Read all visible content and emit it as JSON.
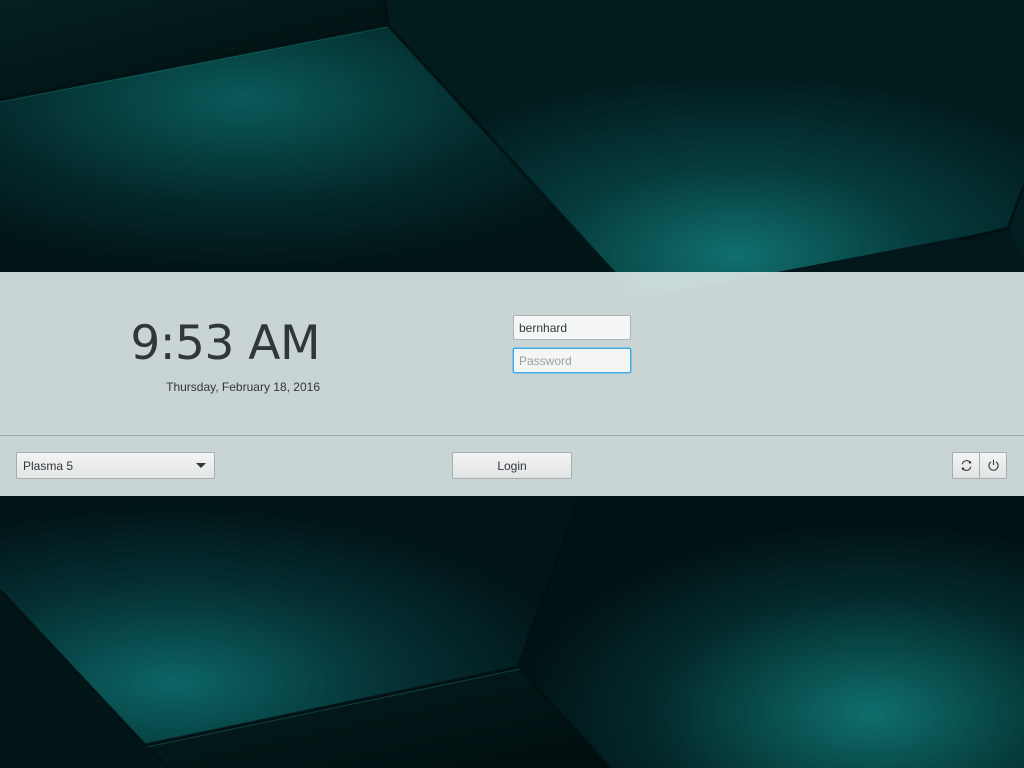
{
  "clock": {
    "time": "9:53 AM",
    "date": "Thursday, February 18, 2016"
  },
  "login": {
    "username_value": "bernhard",
    "password_placeholder": "Password",
    "login_label": "Login"
  },
  "session": {
    "selected": "Plasma 5"
  },
  "power": {
    "reboot_icon": "reboot-icon",
    "shutdown_icon": "shutdown-icon"
  },
  "colors": {
    "band": "#d6e0e0",
    "text": "#31363b",
    "focus": "#3daee9",
    "wallpaper_dark": "#021a1c",
    "wallpaper_teal": "#0e6b6b"
  }
}
